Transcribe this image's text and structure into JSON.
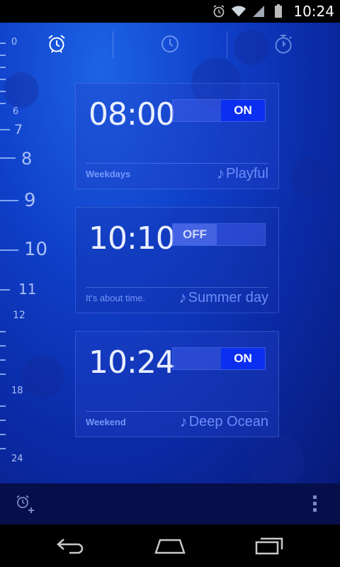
{
  "status_bar": {
    "time": "10:24",
    "icons": [
      "alarm-icon",
      "wifi-icon",
      "signal-icon",
      "battery-icon"
    ]
  },
  "tabs": [
    {
      "name": "alarm",
      "icon": "alarm-clock-icon",
      "active": true
    },
    {
      "name": "clock",
      "icon": "clock-icon",
      "active": false
    },
    {
      "name": "stopwatch",
      "icon": "stopwatch-icon",
      "active": false
    }
  ],
  "timeline": {
    "labels": [
      "0",
      "6",
      "7",
      "8",
      "9",
      "10",
      "11",
      "12",
      "18",
      "24"
    ]
  },
  "alarms": [
    {
      "time": "08:00",
      "toggle": "ON",
      "label": "Weekdays",
      "sound": "Playful"
    },
    {
      "time": "10:10",
      "toggle": "OFF",
      "label": "It's about time.",
      "sound": "Summer day"
    },
    {
      "time": "10:24",
      "toggle": "ON",
      "label": "Weekend",
      "sound": "Deep Ocean"
    }
  ],
  "bottom_bar": {
    "add_icon": "add-alarm-icon",
    "menu_icon": "overflow-menu-icon"
  },
  "nav_bar": {
    "back_icon": "back-icon",
    "home_icon": "home-icon",
    "recents_icon": "recents-icon"
  },
  "colors": {
    "accent": "#0b2ff0",
    "background": "#0f3fc8",
    "text": "#e9efff",
    "muted": "#7f9dff"
  }
}
